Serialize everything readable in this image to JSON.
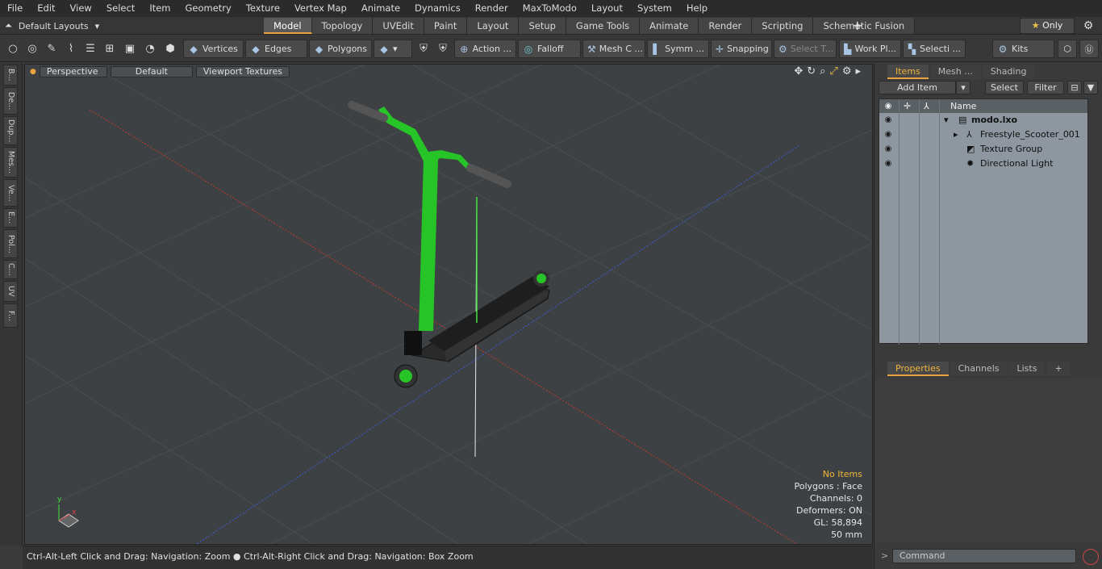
{
  "menu": [
    "File",
    "Edit",
    "View",
    "Select",
    "Item",
    "Geometry",
    "Texture",
    "Vertex Map",
    "Animate",
    "Dynamics",
    "Render",
    "MaxToModo",
    "Layout",
    "System",
    "Help"
  ],
  "layout_selector": "Default Layouts",
  "tabs": [
    "Model",
    "Topology",
    "UVEdit",
    "Paint",
    "Layout",
    "Setup",
    "Game Tools",
    "Animate",
    "Render",
    "Scripting",
    "Schematic Fusion"
  ],
  "active_tab": "Model",
  "only_label": "Only",
  "toolbar": {
    "vertices": "Vertices",
    "edges": "Edges",
    "polygons": "Polygons",
    "action": "Action ...",
    "falloff": "Falloff",
    "mesh_c": "Mesh C ...",
    "symm": "Symm ...",
    "snapping": "Snapping",
    "select_t": "Select T...",
    "work_pl": "Work Pl...",
    "selecti": "Selecti ...",
    "kits": "Kits"
  },
  "left_tabs": [
    "B...",
    "De...",
    "Dup...",
    "Mes...",
    "Ve...",
    "E...",
    "Pol...",
    "C...",
    "UV",
    "F..."
  ],
  "viewport": {
    "perspective": "Perspective",
    "default": "Default",
    "textures": "Viewport Textures",
    "hud": {
      "no_items": "No Items",
      "polygons": "Polygons : Face",
      "channels": "Channels: 0",
      "deformers": "Deformers: ON",
      "gl": "GL: 58,894",
      "scale": "50 mm"
    }
  },
  "status": "Ctrl-Alt-Left Click and Drag: Navigation: Zoom ● Ctrl-Alt-Right Click and Drag: Navigation: Box Zoom",
  "panel": {
    "tabs": [
      "Items",
      "Mesh ...",
      "Shading"
    ],
    "add_item": "Add Item",
    "select": "Select",
    "filter": "Filter",
    "col_name": "Name",
    "tree": [
      {
        "label": "modo.lxo",
        "bold": true
      },
      {
        "label": "Freestyle_Scooter_001"
      },
      {
        "label": "Texture Group"
      },
      {
        "label": "Directional Light"
      }
    ],
    "bottom_tabs": [
      "Properties",
      "Channels",
      "Lists"
    ],
    "command_placeholder": "Command"
  }
}
